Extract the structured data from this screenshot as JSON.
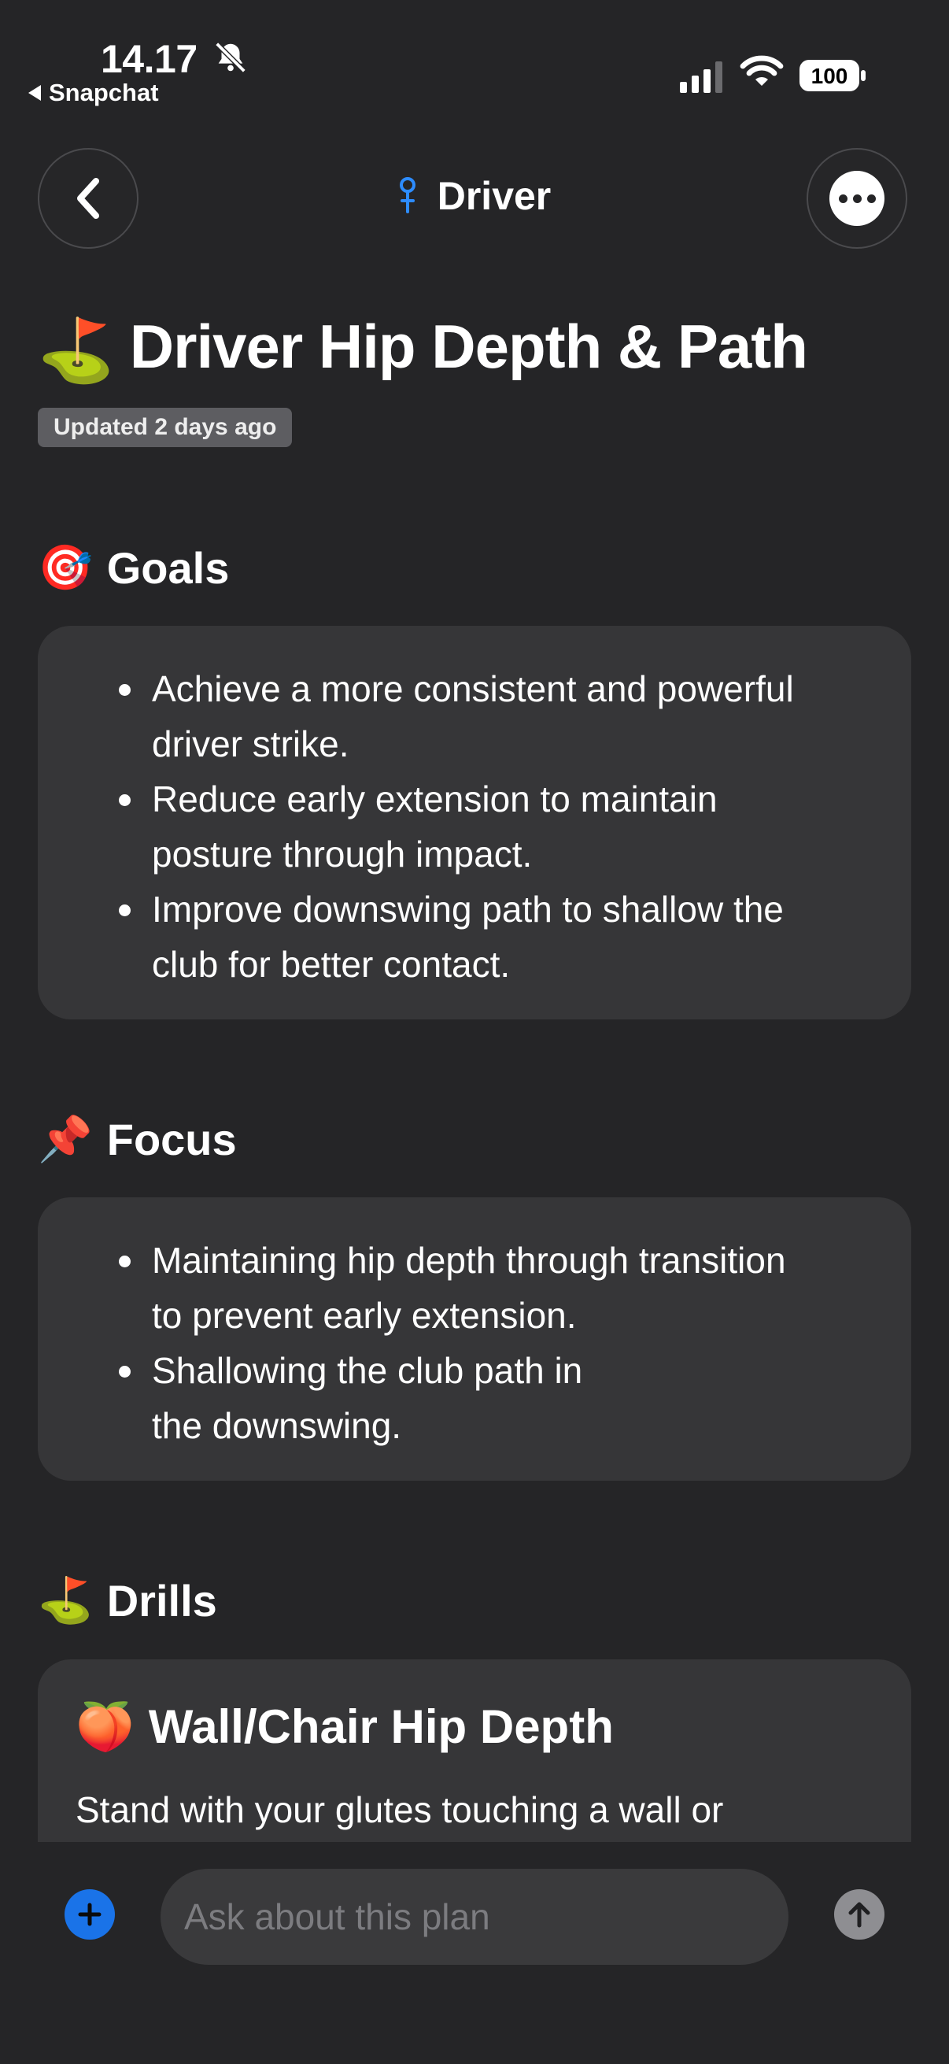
{
  "status_bar": {
    "time": "14.17",
    "back_app": "Snapchat",
    "battery": "100"
  },
  "nav": {
    "title": "Driver"
  },
  "page": {
    "title": "Driver Hip Depth & Path",
    "title_emoji": "⛳",
    "updated": "Updated 2 days ago"
  },
  "goals": {
    "emoji": "🎯",
    "heading": "Goals",
    "items": [
      [
        "Achieve a more consistent and powerful",
        "driver strike."
      ],
      [
        "Reduce early extension to maintain",
        "posture through impact."
      ],
      [
        "Improve downswing path to shallow the",
        "club for better contact."
      ]
    ]
  },
  "focus": {
    "emoji": "📌",
    "heading": "Focus",
    "items": [
      [
        "Maintaining hip depth through transition",
        "to prevent early extension."
      ],
      [
        "Shallowing the club path in",
        "the downswing."
      ]
    ]
  },
  "drills": {
    "emoji": "⛳",
    "heading": "Drills",
    "items": [
      {
        "emoji": "🍑",
        "title": "Wall/Chair Hip Depth",
        "text": "Stand with your glutes touching a wall or"
      }
    ]
  },
  "chat": {
    "placeholder": "Ask about this plan"
  },
  "colors": {
    "accent": "#1a73e8",
    "background": "#252527",
    "card": "#363638"
  }
}
